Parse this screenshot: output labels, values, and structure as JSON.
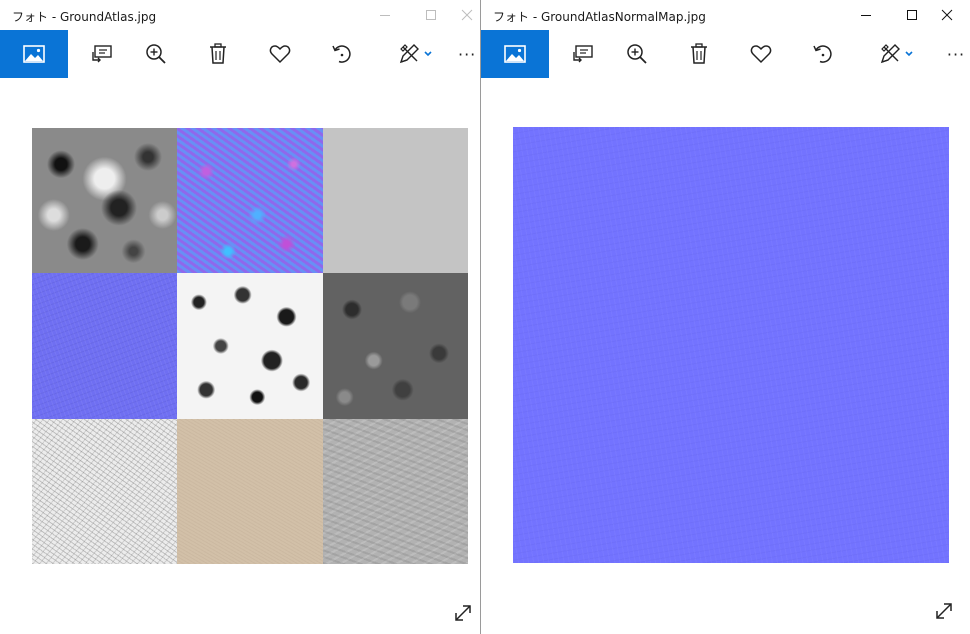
{
  "windows": [
    {
      "title": "フォト - GroundAtlas.jpg",
      "caption_state": "inactive"
    },
    {
      "title": "フォト - GroundAtlasNormalMap.jpg",
      "caption_state": "active"
    }
  ],
  "toolbar": {
    "items": [
      "view-image",
      "slideshow",
      "zoom-in",
      "delete",
      "favorite",
      "rotate",
      "edit-create",
      "more"
    ],
    "more_label": "···"
  },
  "colors": {
    "accent": "#0a74d6",
    "normal_map_blue": "#7373ff"
  }
}
